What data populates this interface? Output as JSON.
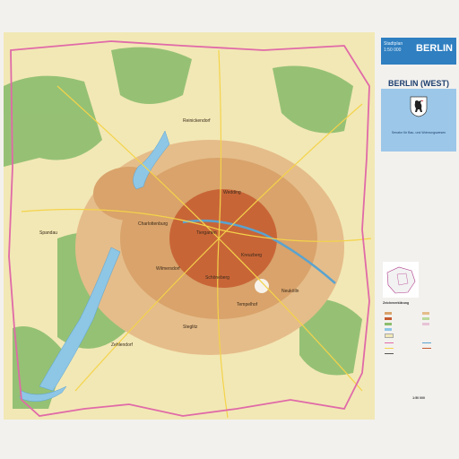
{
  "header": {
    "small_caption": "Stadtplan\n1:50 000",
    "city_title": "BERLIN",
    "subtitle": "BERLIN (WEST)",
    "publisher_note": "Senator für Bau- und Wohnungswesen"
  },
  "map": {
    "districts": [
      "Spandau",
      "Reinickendorf",
      "Charlottenburg",
      "Wilmersdorf",
      "Zehlendorf",
      "Steglitz",
      "Tempelhof",
      "Neukölln",
      "Kreuzberg",
      "Tiergarten",
      "Wedding",
      "Schöneberg"
    ],
    "colors": {
      "forest": "#8cbd6e",
      "built_up": "#d9a36b",
      "dense_center": "#c45a2e",
      "water": "#8ec6e6",
      "border": "#e06aa8",
      "open_land": "#f2e8b5",
      "title_blue": "#2f7fc1"
    }
  },
  "legend": {
    "title": "Zeichenerklärung",
    "scale": "1:50 000"
  }
}
